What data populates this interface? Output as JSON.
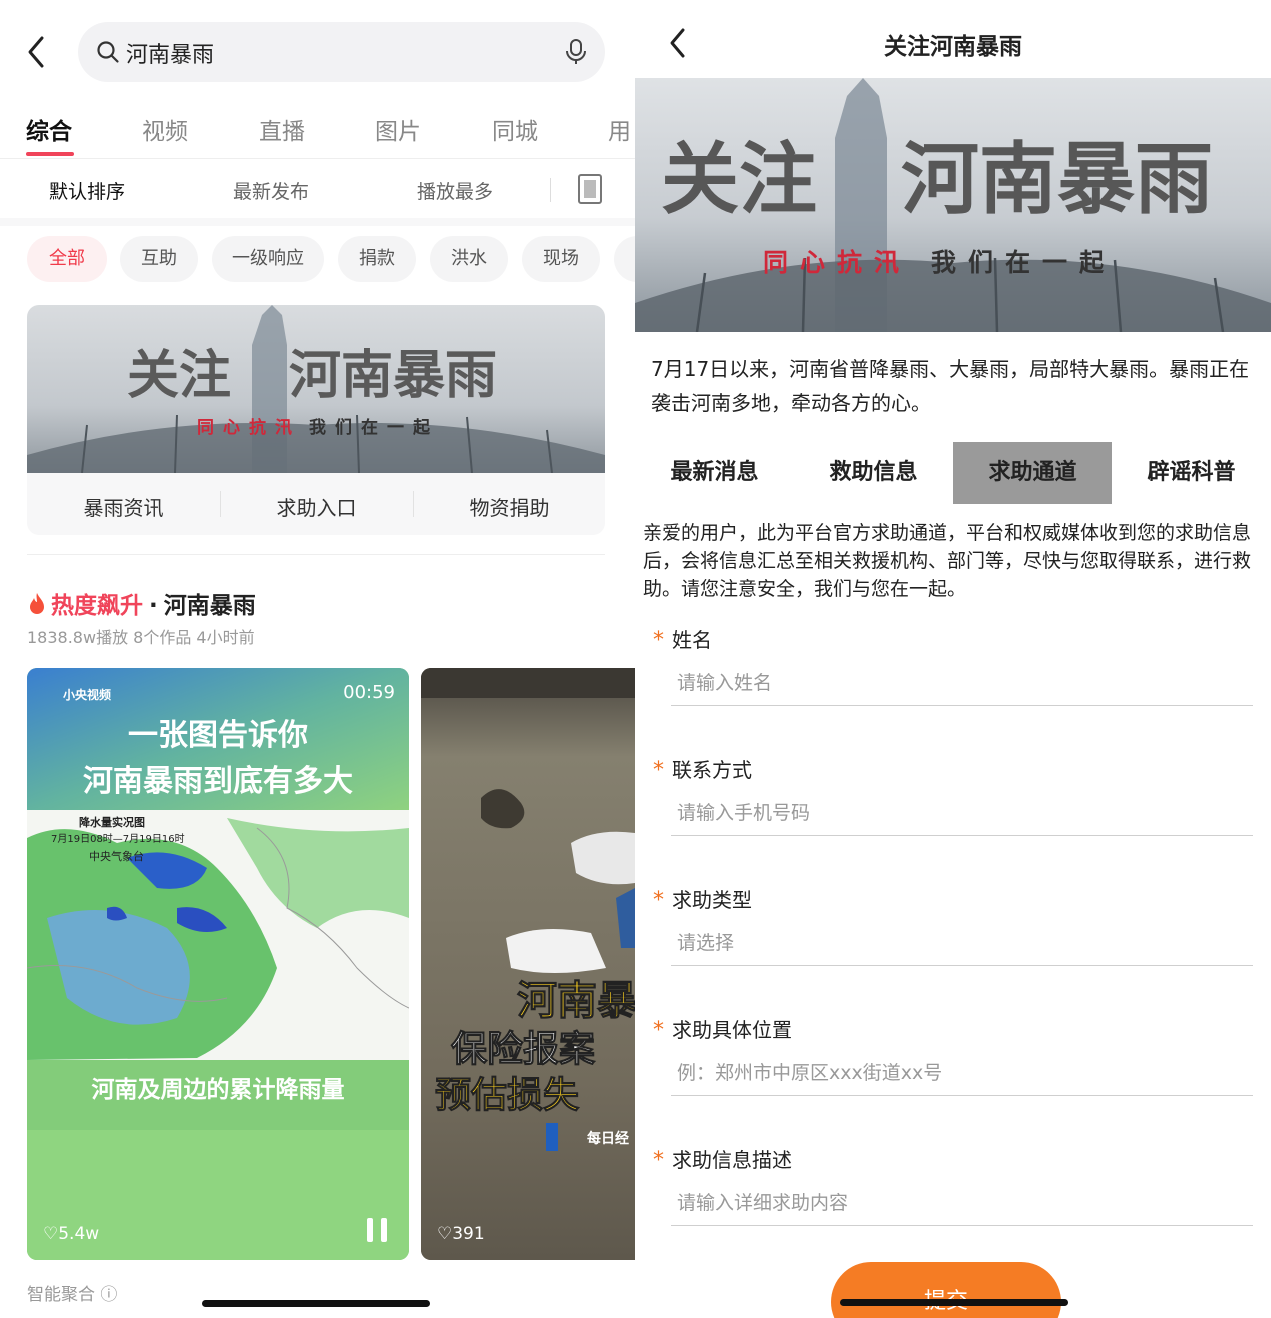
{
  "left": {
    "search": {
      "query": "河南暴雨"
    },
    "tabs": [
      {
        "label": "综合",
        "active": true
      },
      {
        "label": "视频"
      },
      {
        "label": "直播"
      },
      {
        "label": "图片"
      },
      {
        "label": "同城"
      },
      {
        "label": "用"
      }
    ],
    "sorts": [
      {
        "label": "默认排序",
        "active": true
      },
      {
        "label": "最新发布"
      },
      {
        "label": "播放最多"
      }
    ],
    "chips": [
      {
        "label": "全部",
        "active": true
      },
      {
        "label": "互助"
      },
      {
        "label": "一级响应"
      },
      {
        "label": "捐款"
      },
      {
        "label": "洪水"
      },
      {
        "label": "现场"
      }
    ],
    "banner": {
      "title_left": "关注",
      "title_right": "河南暴雨",
      "slogan_red": "同心抗汛",
      "slogan_dark": "我们在一起",
      "links": [
        "暴雨资讯",
        "求助入口",
        "物资捐助"
      ]
    },
    "hot": {
      "tag": "热度飙升",
      "dot": "·",
      "topic": "河南暴雨",
      "meta": "1838.8w播放 8个作品 4小时前"
    },
    "video1": {
      "source": "小央视频",
      "duration": "00:59",
      "headline1": "一张图告诉你",
      "headline2": "河南暴雨到底有多大",
      "map_title": "降水量实况图",
      "map_period": "7月19日08时—7月19日16时",
      "map_org": "中央气象台",
      "caption": "河南及周边的累计降雨量",
      "likes": "♡5.4w"
    },
    "video2": {
      "headline1": "河南暴",
      "headline2": "保险报案",
      "headline3": "预估损失",
      "logo_text": "每日经",
      "likes": "♡391"
    },
    "smart": "智能聚合 ⓘ"
  },
  "right": {
    "title": "关注河南暴雨",
    "banner": {
      "title_left": "关注",
      "title_right": "河南暴雨",
      "slogan_red": "同心抗汛",
      "slogan_dark": "我们在一起"
    },
    "intro": "7月17日以来，河南省普降暴雨、大暴雨，局部特大暴雨。暴雨正在袭击河南多地，牵动各方的心。",
    "tabs": [
      {
        "label": "最新消息"
      },
      {
        "label": "救助信息"
      },
      {
        "label": "求助通道",
        "active": true
      },
      {
        "label": "辟谣科普"
      }
    ],
    "notice": "亲爱的用户，此为平台官方求助通道，平台和权威媒体收到您的求助信息后，会将信息汇总至相关救援机构、部门等，尽快与您取得联系，进行救助。请您注意安全，我们与您在一起。",
    "fields": [
      {
        "label": "姓名",
        "placeholder": "请输入姓名"
      },
      {
        "label": "联系方式",
        "placeholder": "请输入手机号码"
      },
      {
        "label": "求助类型",
        "placeholder": "请选择"
      },
      {
        "label": "求助具体位置",
        "placeholder": "例：郑州市中原区xxx街道xx号"
      },
      {
        "label": "求助信息描述",
        "placeholder": "请输入详细求助内容"
      }
    ],
    "required_mark": "*",
    "submit": "提交"
  },
  "colors": {
    "accent_red": "#f0445a",
    "accent_orange": "#f57c24",
    "active_tab_gray": "#9a9a9a"
  }
}
